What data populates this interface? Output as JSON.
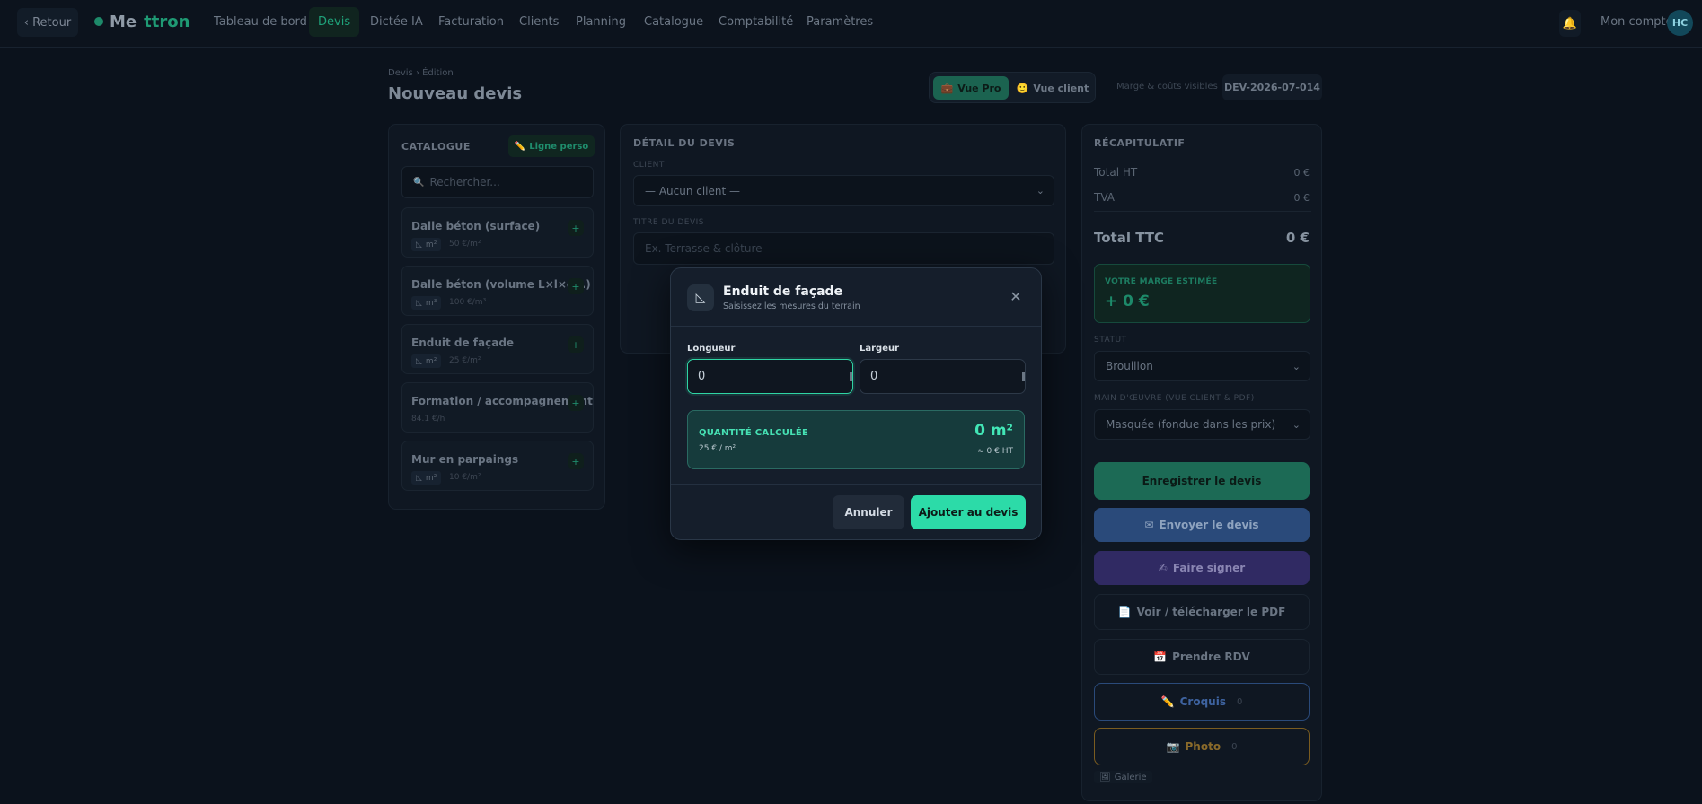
{
  "nav": {
    "back_label": "‹ Retour",
    "logo_a": "Me",
    "logo_b": "ttron",
    "items": [
      "Tableau de bord",
      "Devis",
      "Dictée IA",
      "Facturation",
      "Clients",
      "Planning",
      "Catalogue",
      "Comptabilité",
      "Paramètres"
    ],
    "active_item": "Devis",
    "bell_icon": "bell-icon",
    "account_label": "Mon compte",
    "avatar_initials": "HC"
  },
  "header": {
    "breadcrumb": "Devis › Édition",
    "title": "Nouveau devis",
    "view_pro": "Vue Pro",
    "view_client": "Vue client",
    "margin_note": "Marge & coûts visibles",
    "quote_number": "DEV-2026-07-014"
  },
  "catalogue": {
    "title": "CATALOGUE",
    "custom_line": "Ligne perso",
    "search_placeholder": "Rechercher...",
    "items": [
      {
        "name": "Dalle béton (surface)",
        "unit": "m²",
        "price": "50 €/m²"
      },
      {
        "name": "Dalle béton (volume L×l×ép.)",
        "unit": "m³",
        "price": "100 €/m³"
      },
      {
        "name": "Enduit de façade",
        "unit": "m²",
        "price": "25 €/m²"
      },
      {
        "name": "Formation / accompagnement",
        "unit": "",
        "price": "84.1 €/h"
      },
      {
        "name": "Mur en parpaings",
        "unit": "m²",
        "price": "10 €/m²"
      }
    ]
  },
  "detail": {
    "title": "DÉTAIL DU DEVIS",
    "client_label": "CLIENT",
    "client_value": "— Aucun client —",
    "quote_title_label": "TITRE DU DEVIS",
    "quote_title_placeholder": "Ex. Terrasse & clôture"
  },
  "summary": {
    "title": "RÉCAPITULATIF",
    "total_ht_label": "Total HT",
    "total_ht_value": "0 €",
    "tva_label": "TVA",
    "tva_value": "0 €",
    "total_ttc_label": "Total TTC",
    "total_ttc_value": "0 €",
    "margin_label": "VOTRE MARGE ESTIMÉE",
    "margin_value": "+ 0 €",
    "status_label": "STATUT",
    "status_value": "Brouillon",
    "labour_label": "MAIN D'ŒUVRE (VUE CLIENT & PDF)",
    "labour_value": "Masquée (fondue dans les prix)",
    "save": "Enregistrer le devis",
    "send": "Envoyer le devis",
    "sign": "Faire signer",
    "pdf": "Voir / télécharger le PDF",
    "rdv": "Prendre RDV",
    "sketch": "Croquis",
    "sketch_count": "0",
    "photo": "Photo",
    "photo_count": "0",
    "gallery": "Galerie"
  },
  "modal": {
    "title": "Enduit de façade",
    "subtitle": "Saisissez les mesures du terrain",
    "length_label": "Longueur",
    "length_value": "0",
    "width_label": "Largeur",
    "width_value": "0",
    "qty_label": "QUANTITÉ CALCULÉE",
    "qty_unit_price": "25 € / m²",
    "qty_value": "0 m²",
    "qty_ht": "≈ 0 € HT",
    "cancel": "Annuler",
    "add": "Ajouter au devis"
  },
  "colors": {
    "accent": "#2cdba8",
    "background": "#0b121c",
    "send_blue": "#2c5aa0",
    "sign_purple": "#3b2f7a",
    "photo_border": "#8a6a24"
  }
}
